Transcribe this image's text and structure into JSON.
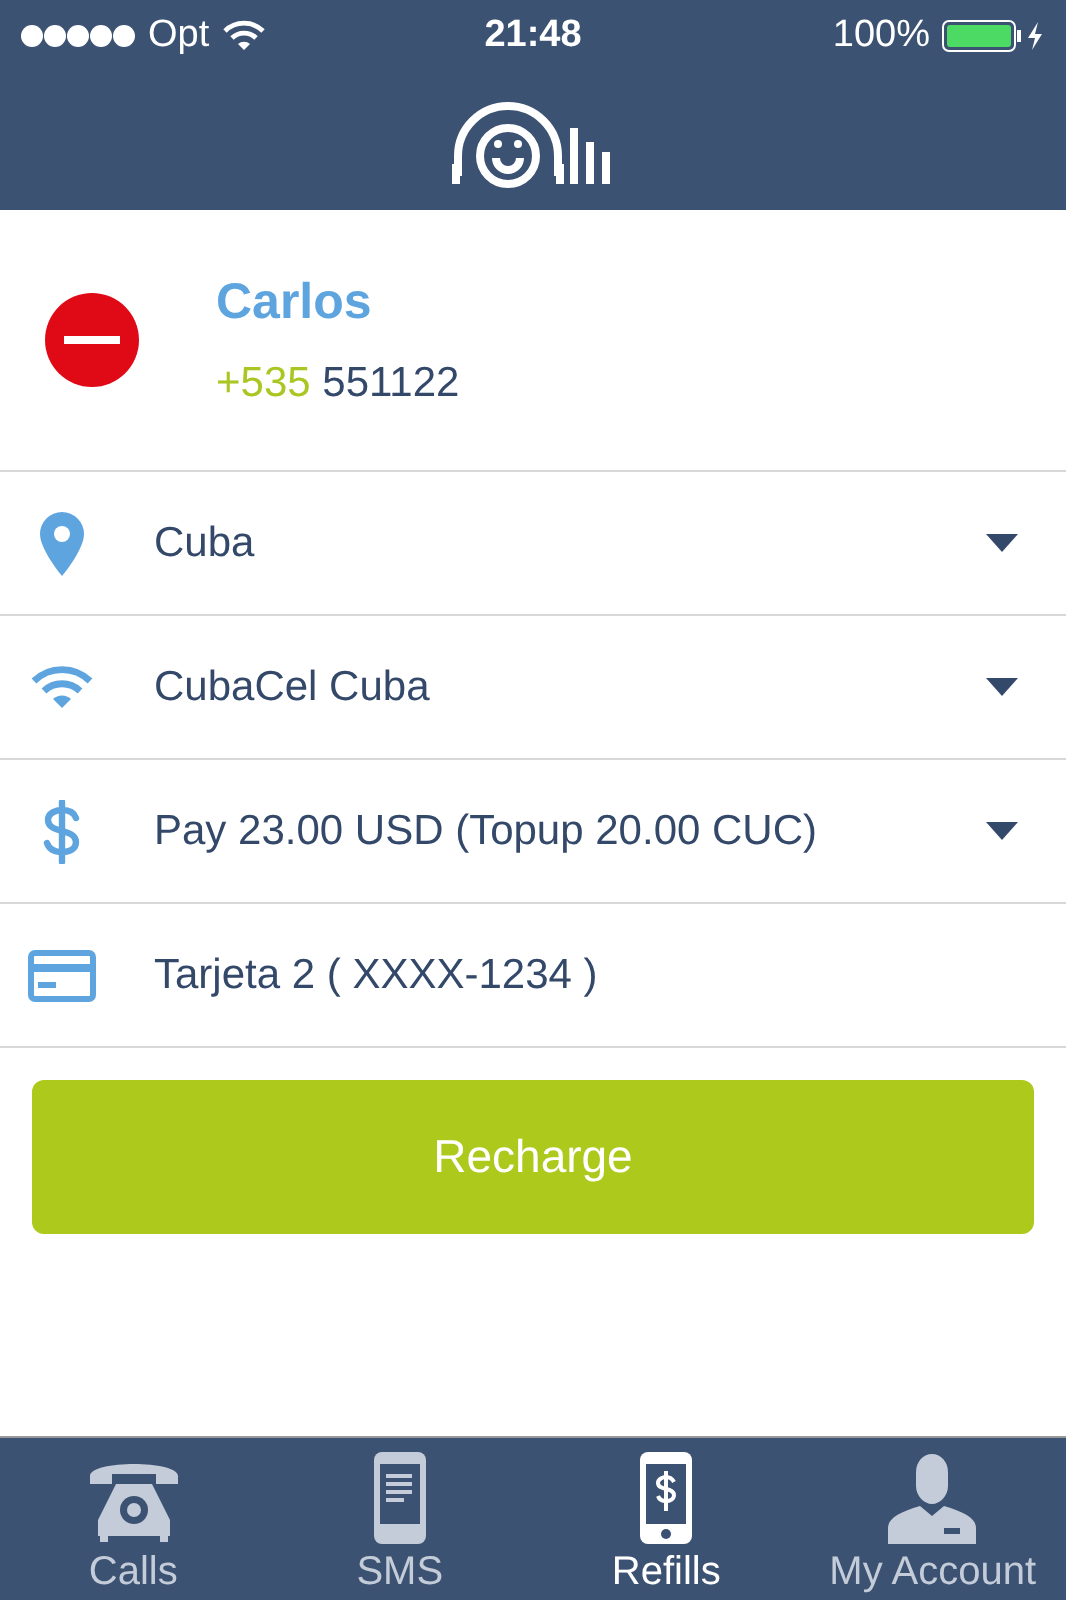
{
  "status_bar": {
    "carrier": "Opt",
    "time": "21:48",
    "battery": "100%"
  },
  "contact": {
    "name": "Carlos",
    "country_code": "+535",
    "number": "551122"
  },
  "options": [
    {
      "kind": "location",
      "value": "Cuba",
      "dropdown": true
    },
    {
      "kind": "network",
      "value": "CubaCel Cuba",
      "dropdown": true
    },
    {
      "kind": "amount",
      "value": "Pay 23.00 USD (Topup 20.00 CUC)",
      "dropdown": true
    },
    {
      "kind": "card",
      "value": "Tarjeta 2 ( XXXX-1234 )",
      "dropdown": false
    }
  ],
  "action_button": "Recharge",
  "tabs": [
    {
      "kind": "calls",
      "label": "Calls",
      "selected": false
    },
    {
      "kind": "sms",
      "label": "SMS",
      "selected": false
    },
    {
      "kind": "refills",
      "label": "Refills",
      "selected": true
    },
    {
      "kind": "account",
      "label": "My Account",
      "selected": false
    }
  ]
}
